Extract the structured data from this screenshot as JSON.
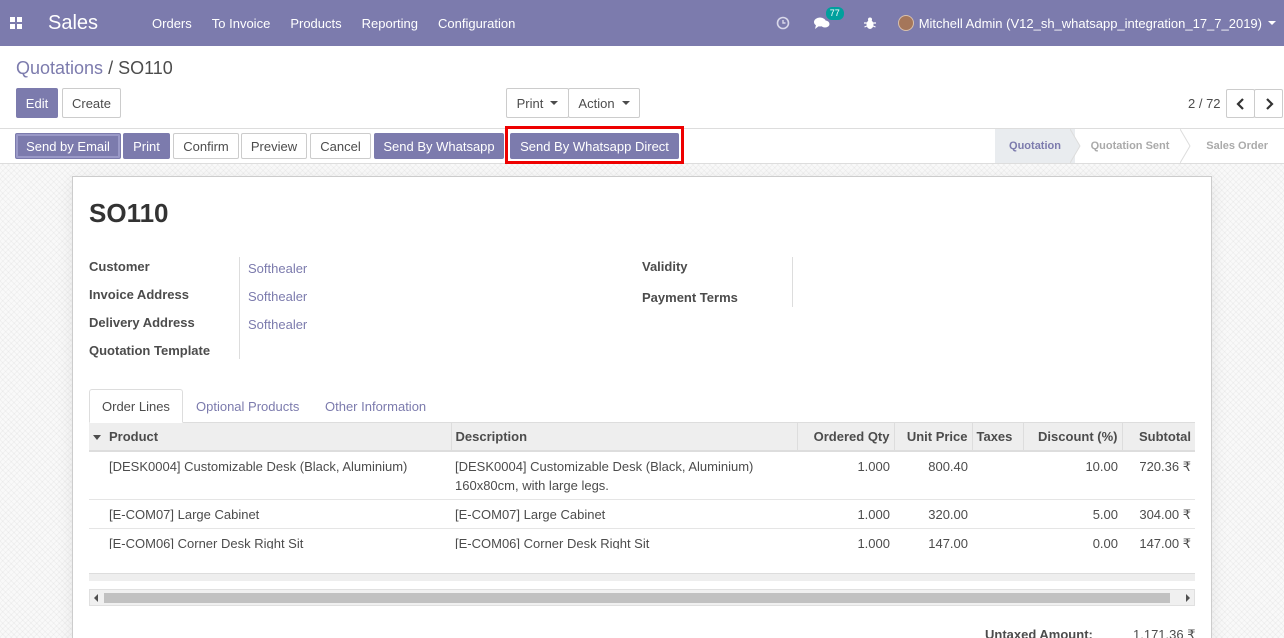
{
  "navbar": {
    "app_name": "Sales",
    "menu": [
      "Orders",
      "To Invoice",
      "Products",
      "Reporting",
      "Configuration"
    ],
    "messages_count": "77",
    "user": "Mitchell Admin (V12_sh_whatsapp_integration_17_7_2019)",
    "background": "#7c7bad"
  },
  "breadcrumb": {
    "parent": "Quotations",
    "separator": "/",
    "current": "SO110"
  },
  "control_buttons": {
    "edit": "Edit",
    "create": "Create",
    "print": "Print",
    "action": "Action"
  },
  "pager": {
    "value": "2 / 72"
  },
  "status_buttons": {
    "send_email": "Send by Email",
    "print": "Print",
    "confirm": "Confirm",
    "preview": "Preview",
    "cancel": "Cancel",
    "whatsapp": "Send By Whatsapp",
    "whatsapp_direct": "Send By Whatsapp Direct"
  },
  "stages": [
    "Quotation",
    "Quotation Sent",
    "Sales Order"
  ],
  "form": {
    "title": "SO110",
    "left_labels": [
      "Customer",
      "Invoice Address",
      "Delivery Address",
      "Quotation Template"
    ],
    "left_values": [
      "Softhealer",
      "Softhealer",
      "Softhealer",
      ""
    ],
    "right_labels": [
      "Validity",
      "Payment Terms"
    ]
  },
  "tabs": [
    "Order Lines",
    "Optional Products",
    "Other Information"
  ],
  "table": {
    "headers": [
      "Product",
      "Description",
      "Ordered Qty",
      "Unit Price",
      "Taxes",
      "Discount (%)",
      "Subtotal"
    ],
    "rows": [
      {
        "product": "[DESK0004] Customizable Desk (Black, Aluminium)",
        "description": "[DESK0004] Customizable Desk (Black, Aluminium)",
        "description2": "160x80cm, with large legs.",
        "qty": "1.000",
        "price": "800.40",
        "taxes": "",
        "discount": "10.00",
        "subtotal": "720.36 ₹"
      },
      {
        "product": "[E-COM07] Large Cabinet",
        "description": "[E-COM07] Large Cabinet",
        "description2": "",
        "qty": "1.000",
        "price": "320.00",
        "taxes": "",
        "discount": "5.00",
        "subtotal": "304.00 ₹"
      },
      {
        "product": "[E-COM06] Corner Desk Right Sit",
        "description": "[E-COM06] Corner Desk Right Sit",
        "description2": "",
        "qty": "1.000",
        "price": "147.00",
        "taxes": "",
        "discount": "0.00",
        "subtotal": "147.00 ₹"
      }
    ]
  },
  "totals": {
    "untaxed_label": "Untaxed Amount:",
    "untaxed_value": "1,171.36 ₹"
  }
}
